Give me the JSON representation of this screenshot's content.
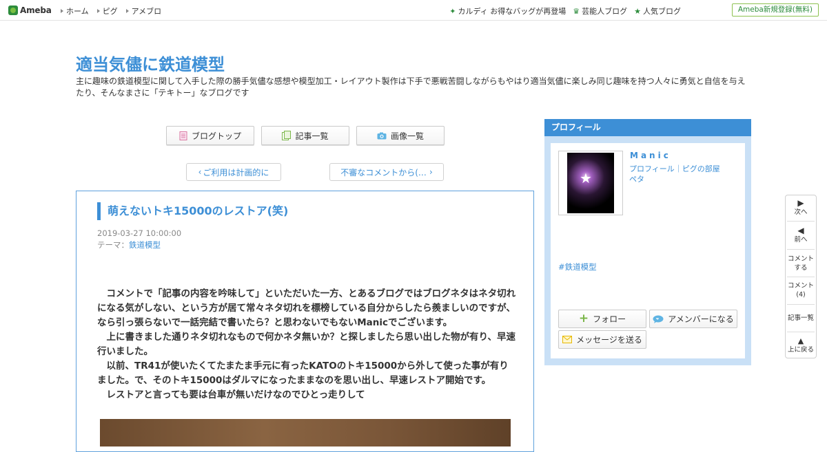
{
  "topbar": {
    "logo": "Ameba",
    "nav": [
      "ホーム",
      "ピグ",
      "アメブロ"
    ],
    "right_links": [
      {
        "icon": "diamond-icon",
        "label": "カルディ お得なバッグが再登場"
      },
      {
        "icon": "crown-icon",
        "label": "芸能人ブログ"
      },
      {
        "icon": "star-icon",
        "label": "人気ブログ"
      }
    ],
    "signup": "Ameba新規登録(無料)"
  },
  "header": {
    "title": "適当気儘に鉄道模型",
    "description": "主に趣味の鉄道模型に関して入手した際の勝手気儘な感想や模型加工・レイアウト製作は下手で悪戦苦闘しながらもやはり適当気儘に楽しみ同じ趣味を持つ人々に勇気と自信を与えたり、そんなまさに「テキトー」なブログです"
  },
  "tabs": [
    {
      "icon": "document-icon",
      "label": "ブログトップ"
    },
    {
      "icon": "copy-icon",
      "label": "記事一覧"
    },
    {
      "icon": "camera-icon",
      "label": "画像一覧"
    }
  ],
  "pager": {
    "prev": "ご利用は計画的に",
    "next": "不審なコメントから(…"
  },
  "article": {
    "title": "萌えないトキ15000のレストア(笑)",
    "date": "2019-03-27 10:00:00",
    "theme_prefix": "テーマ：",
    "theme": "鉄道模型",
    "body": [
      "　コメントで「記事の内容を吟味して」といただいた一方、とあるブログではブログネタはネタ切れになる気がしない、という方が居て常々ネタ切れを標榜している自分からしたら羨ましいのですが、なら引っ張らないで一話完結で書いたら？と思わないでもないManicでございます。",
      "　上に書きました通りネタ切れなもので何かネタ無いか？と探しましたら思い出した物が有り、早速行いました。",
      "　以前、TR41が使いたくてたまたま手元に有ったKATOのトキ15000から外して使った事が有りました。で、そのトキ15000はダルマになったままなのを思い出し、早速レストア開始です。",
      "　レストアと言っても要は台車が無いだけなのでひとっ走りして"
    ]
  },
  "profile": {
    "heading": "プロフィール",
    "name": "Manic",
    "link_profile": "プロフィール",
    "link_sep": "｜",
    "link_pig": "ピグの部屋",
    "link_peta": "ペタ",
    "hashtag": "#鉄道模型",
    "follow": "フォロー",
    "member": "アメンバーになる",
    "message": "メッセージを送る"
  },
  "floatnav": {
    "next": "次へ",
    "prev": "前へ",
    "comment_a": "コメント",
    "comment_b": "する",
    "comments_a": "コメント",
    "comments_b": "(4)",
    "list": "記事一覧",
    "top": "上に戻る"
  },
  "colors": {
    "accent": "#3d8fd6",
    "brand_green": "#2d8c3c",
    "profile_bg": "#c9e0f6"
  }
}
